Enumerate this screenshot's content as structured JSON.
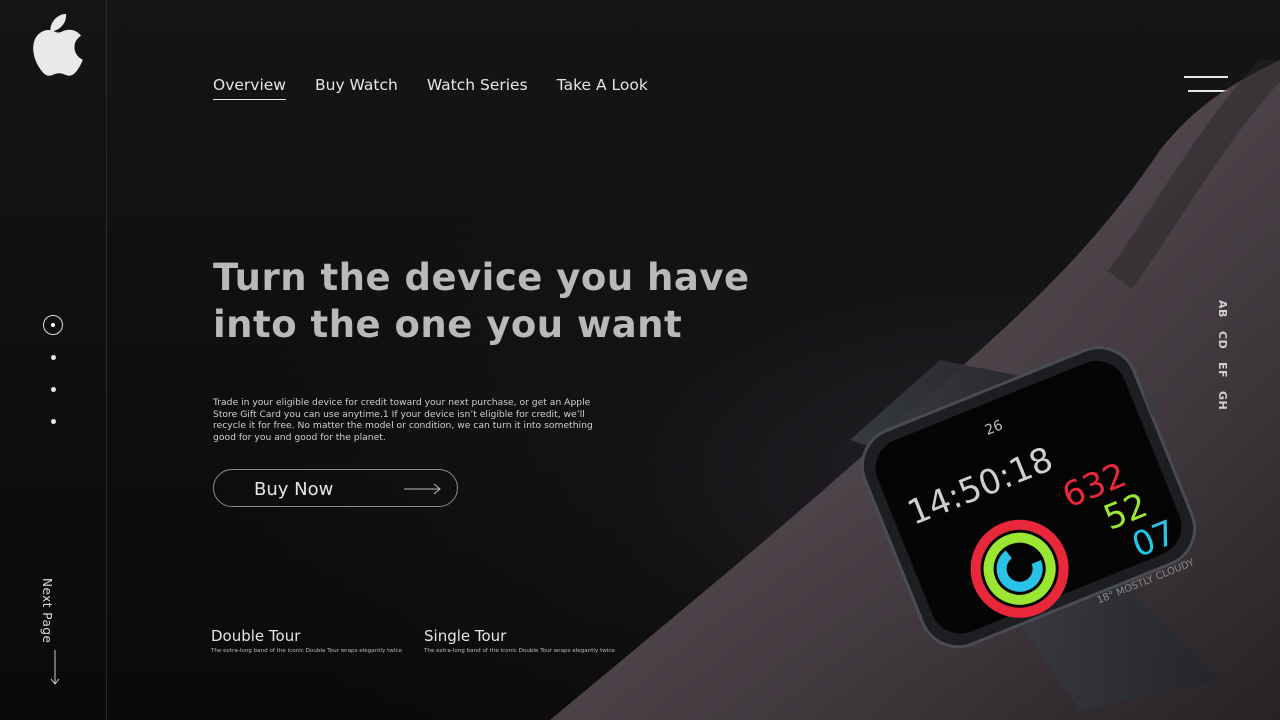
{
  "nav": {
    "items": [
      {
        "label": "Overview",
        "active": true
      },
      {
        "label": "Buy Watch",
        "active": false
      },
      {
        "label": "Watch Series",
        "active": false
      },
      {
        "label": "Take A Look",
        "active": false
      }
    ]
  },
  "hero": {
    "title_line1": "Turn the device you have",
    "title_line2": "into the one you want",
    "description": "Trade in your eligible device for credit toward your next purchase, or get an Apple Store Gift Card you can use anytime.1 If your device isn’t eligible for credit, we’ll recycle it for free. No matter the model or condition, we can turn it into something good for you and good for the planet.",
    "cta_label": "Buy Now"
  },
  "sidebar": {
    "next_page_label": "Next Page",
    "slide_count": 4,
    "active_slide": 1
  },
  "tours": [
    {
      "title": "Double Tour",
      "desc": "The extra-long band of the iconic Double Tour wraps elegantly twice"
    },
    {
      "title": "Single Tour",
      "desc": "The extra-long band of the iconic Double Tour wraps elegantly twice"
    }
  ],
  "side_labels": [
    "AB",
    "CD",
    "EF",
    "GH"
  ],
  "watch": {
    "date": "26",
    "time": "14:50:18",
    "move": "632",
    "exercise": "52",
    "stand": "07",
    "weather": "18° MOSTLY CLOUDY"
  },
  "colors": {
    "background": "#0b0b0c",
    "move_ring": "#e8273a",
    "exercise_ring": "#9be633",
    "stand_ring": "#2ac3e8"
  },
  "icons": [
    "apple-logo-icon",
    "menu-icon",
    "arrow-right-icon",
    "arrow-down-icon"
  ]
}
